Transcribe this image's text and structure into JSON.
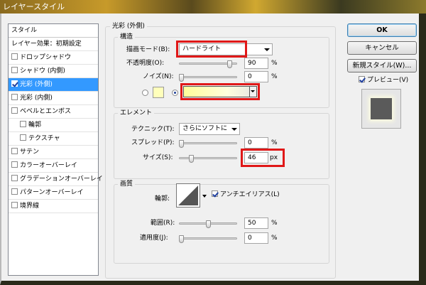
{
  "window": {
    "title": "レイヤースタイル"
  },
  "sidebar": {
    "header": "スタイル",
    "items": [
      {
        "label": "レイヤー効果：初期設定",
        "checkbox": false,
        "checked": false,
        "selected": false,
        "indent": false
      },
      {
        "label": "ドロップシャドウ",
        "checkbox": true,
        "checked": false,
        "selected": false,
        "indent": false
      },
      {
        "label": "シャドウ (内側)",
        "checkbox": true,
        "checked": false,
        "selected": false,
        "indent": false
      },
      {
        "label": "光彩 (外側)",
        "checkbox": true,
        "checked": true,
        "selected": true,
        "indent": false
      },
      {
        "label": "光彩 (内側)",
        "checkbox": true,
        "checked": false,
        "selected": false,
        "indent": false
      },
      {
        "label": "ベベルとエンボス",
        "checkbox": true,
        "checked": false,
        "selected": false,
        "indent": false
      },
      {
        "label": "輪郭",
        "checkbox": true,
        "checked": false,
        "selected": false,
        "indent": true
      },
      {
        "label": "テクスチャ",
        "checkbox": true,
        "checked": false,
        "selected": false,
        "indent": true
      },
      {
        "label": "サテン",
        "checkbox": true,
        "checked": false,
        "selected": false,
        "indent": false
      },
      {
        "label": "カラーオーバーレイ",
        "checkbox": true,
        "checked": false,
        "selected": false,
        "indent": false
      },
      {
        "label": "グラデーションオーバーレイ",
        "checkbox": true,
        "checked": false,
        "selected": false,
        "indent": false
      },
      {
        "label": "パターンオーバーレイ",
        "checkbox": true,
        "checked": false,
        "selected": false,
        "indent": false
      },
      {
        "label": "境界線",
        "checkbox": true,
        "checked": false,
        "selected": false,
        "indent": false
      }
    ]
  },
  "panel": {
    "title": "光彩 (外側)",
    "structure": {
      "title": "構造",
      "blend_mode": {
        "label": "描画モード(B):",
        "value": "ハードライト"
      },
      "opacity": {
        "label": "不透明度(O):",
        "value": "90",
        "unit": "%",
        "percent": 90
      },
      "noise": {
        "label": "ノイズ(N):",
        "value": "0",
        "unit": "%",
        "percent": 0
      }
    },
    "elements": {
      "title": "エレメント",
      "technique": {
        "label": "テクニック(T):",
        "value": "さらにソフトに"
      },
      "spread": {
        "label": "スプレッド(P):",
        "value": "0",
        "unit": "%",
        "percent": 0
      },
      "size": {
        "label": "サイズ(S):",
        "value": "46",
        "unit": "px",
        "percent": 18
      }
    },
    "quality": {
      "title": "画質",
      "contour": {
        "label": "輪郭:"
      },
      "antialias": {
        "label": "アンチエイリアス(L)",
        "checked": true
      },
      "range": {
        "label": "範囲(R):",
        "value": "50",
        "unit": "%",
        "percent": 50
      },
      "jitter": {
        "label": "適用度(J):",
        "value": "0",
        "unit": "%",
        "percent": 0
      }
    }
  },
  "buttons": {
    "ok": "OK",
    "cancel": "キャンセル",
    "new_style": "新規スタイル(W)...",
    "preview": "プレビュー(V)",
    "preview_checked": true
  },
  "colors": {
    "selection": "#3399ff",
    "highlight_box": "#e01818",
    "glow_color": "#ffffbb"
  }
}
